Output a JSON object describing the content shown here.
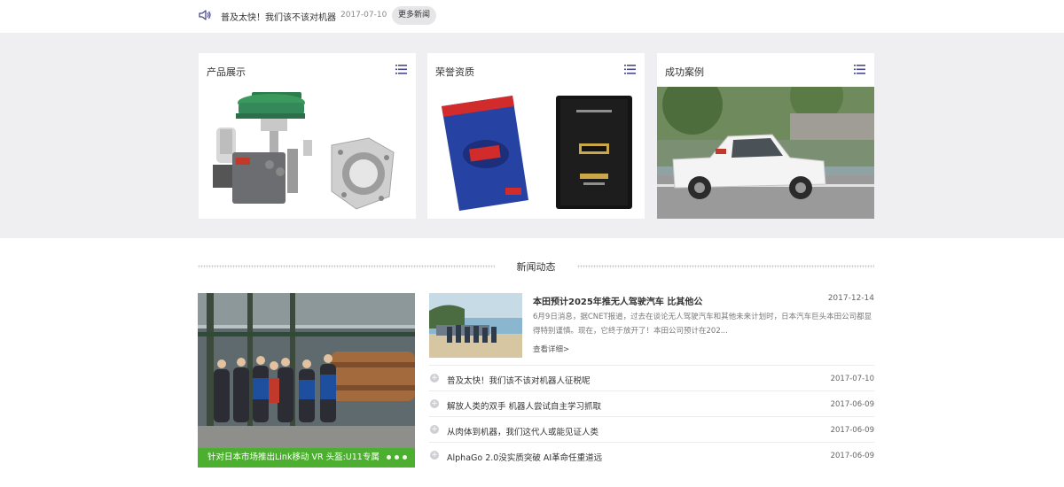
{
  "topbar": {
    "icon": "speaker-icon",
    "headline": "普及太快！我们该不该对机器",
    "date": "2017-07-10",
    "more_label": "更多新闻"
  },
  "cards": [
    {
      "title": "产品展示",
      "icon": "list-icon",
      "image": "control-valve-photo"
    },
    {
      "title": "荣誉资质",
      "icon": "list-icon",
      "image": "catalog-books-photo"
    },
    {
      "title": "成功案例",
      "icon": "list-icon",
      "image": "pickup-truck-photo"
    }
  ],
  "news": {
    "section_title": "新闻动态",
    "slideshow": {
      "caption": "针对日本市场推出Link移动 VR 头盔:U11专属",
      "image": "factory-team-photo",
      "dots": 3
    },
    "feature": {
      "title": "本田预计2025年推无人驾驶汽车 比其他公",
      "date": "2017-12-14",
      "summary": "6月9日消息，据CNET报道，过去在谈论无人驾驶汽车和其他未来计划时，日本汽车巨头本田公司都显得特别谨慎。现在，它终于放开了！本田公司预计在202...",
      "more_label": "查看详细>",
      "image": "beach-group-photo"
    },
    "items": [
      {
        "title": "普及太快！我们该不该对机器人征税呢",
        "date": "2017-07-10"
      },
      {
        "title": "解放人类的双手 机器人尝试自主学习抓取",
        "date": "2017-06-09"
      },
      {
        "title": "从肉体到机器，我们这代人或能见证人类",
        "date": "2017-06-09"
      },
      {
        "title": "AlphaGo 2.0没实质突破 AI革命任重道远",
        "date": "2017-06-09"
      }
    ]
  },
  "colors": {
    "band": "#efeff1",
    "caption_green": "#4caf2f",
    "icon_purple": "#4a4a8a"
  }
}
